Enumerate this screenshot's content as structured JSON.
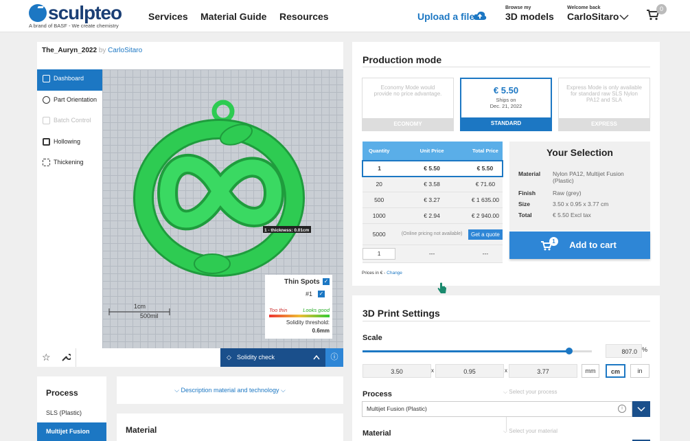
{
  "brand": {
    "name": "sculpteo",
    "tagline": "A brand of BASF - We create chemistry"
  },
  "nav": {
    "services": "Services",
    "material_guide": "Material Guide",
    "resources": "Resources",
    "upload": "Upload a file",
    "browse_small": "Browse my",
    "browse_big": "3D models",
    "welcome_small": "Welcome back",
    "username": "CarloSitaro",
    "cart_count": "0"
  },
  "model": {
    "name": "The_Auryn_2022",
    "by": "by",
    "author": "CarloSitaro"
  },
  "sidebar": {
    "items": [
      {
        "label": "Dashboard"
      },
      {
        "label": "Part Orientation"
      },
      {
        "label": "Batch Control"
      },
      {
        "label": "Hollowing"
      },
      {
        "label": "Thickening"
      }
    ]
  },
  "viewer": {
    "thickness_label": "1 - thickness: 0.01cm",
    "scale_cm": "1cm",
    "scale_mil": "500mil",
    "thin_spots": "Thin Spots",
    "spot_item": "#1",
    "too_thin": "Too thin",
    "looks_good": "Looks good",
    "threshold_label": "Solidity threshold:",
    "threshold_value": "0.6mm",
    "solidity_check": "Solidity check"
  },
  "production": {
    "title": "Production mode",
    "economy": {
      "text": "Economy Mode would provide no price advantage.",
      "label": "ECONOMY"
    },
    "standard": {
      "price": "€ 5.50",
      "ships": "Ships on",
      "date": "Dec. 21, 2022",
      "label": "STANDARD"
    },
    "express": {
      "text": "Express Mode is only available for standard raw SLS Nylon PA12 and SLA",
      "label": "EXPRESS"
    },
    "table": {
      "headers": [
        "Quantity",
        "Unit Price",
        "Total Price"
      ],
      "rows": [
        {
          "q": "1",
          "u": "€ 5.50",
          "t": "€ 5.50"
        },
        {
          "q": "20",
          "u": "€ 3.58",
          "t": "€ 71.60"
        },
        {
          "q": "500",
          "u": "€ 3.27",
          "t": "€ 1 635.00"
        },
        {
          "q": "1000",
          "u": "€ 2.94",
          "t": "€ 2 940.00"
        }
      ],
      "row5000": {
        "q": "5000",
        "u": "(Online pricing not available)",
        "t": "Get a quote"
      },
      "custom": {
        "q": "1",
        "u": "---",
        "t": "---"
      }
    },
    "prices_in": "Prices in € -",
    "change": "Change",
    "selection": {
      "title": "Your Selection",
      "material_k": "Material",
      "material_v": "Nylon PA12, Multijet Fusion (Plastic)",
      "finish_k": "Finish",
      "finish_v": "Raw (grey)",
      "size_k": "Size",
      "size_v": "3.50 x 0.95 x 3.77 cm",
      "total_k": "Total",
      "total_v": "€ 5.50 Excl tax"
    },
    "add_to_cart": "Add to cart",
    "cart_badge": "1"
  },
  "print": {
    "title": "3D Print Settings",
    "scale_label": "Scale",
    "scale_value": "807.0",
    "scale_unit": "%",
    "scale_fraction": 0.9,
    "x": "3.50",
    "y": "0.95",
    "z": "3.77",
    "sep": "x",
    "units": [
      "mm",
      "cm",
      "in"
    ],
    "process_label": "Process",
    "process_hint": "Select your process",
    "process_value": "Multijet Fusion (Plastic)",
    "material_label": "Material",
    "material_hint": "Select your material"
  },
  "lower": {
    "description": "Description material and technology",
    "process_title": "Process",
    "process_items": [
      "SLS (Plastic)",
      "Multijet Fusion"
    ],
    "material_title": "Material"
  },
  "colors": {
    "accent": "#1c77c3",
    "model": "#2ecb52"
  }
}
